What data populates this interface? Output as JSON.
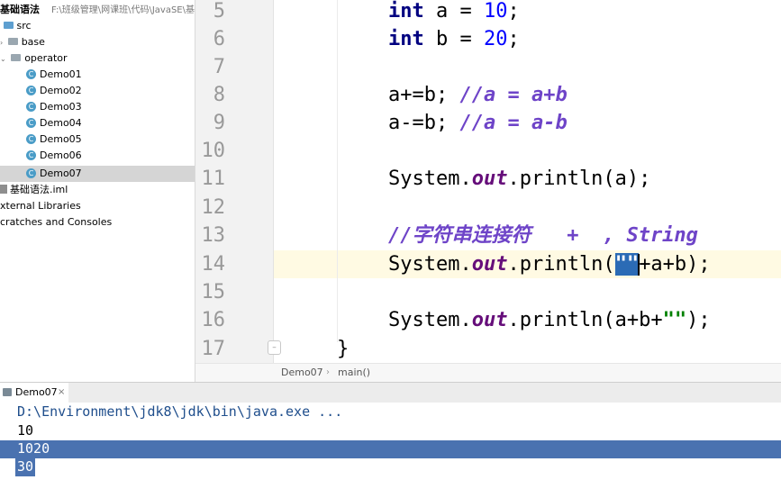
{
  "project": {
    "root_name": "基础语法",
    "root_path": "F:\\班级管理\\网课班\\代码\\JavaSE\\基础",
    "src_label": "src",
    "base_label": "base",
    "operator_label": "operator",
    "files": [
      "Demo01",
      "Demo02",
      "Demo03",
      "Demo04",
      "Demo05",
      "Demo06",
      "Demo07"
    ],
    "selected_file": "Demo07",
    "iml_label": "基础语法.iml",
    "external_libraries": "xternal Libraries",
    "scratches": "cratches and Consoles"
  },
  "editor": {
    "line_numbers": [
      "5",
      "6",
      "7",
      "8",
      "9",
      "10",
      "11",
      "12",
      "13",
      "14",
      "15",
      "16",
      "17"
    ],
    "current_line": "14",
    "code": {
      "l5_kw": "int",
      "l5_rest": " a = ",
      "l5_num": "10",
      "l5_end": ";",
      "l6_kw": "int",
      "l6_rest": " b = ",
      "l6_num": "20",
      "l6_end": ";",
      "l8_code": "a+=b; ",
      "l8_comment": "//a = a+b",
      "l9_code": "a-=b; ",
      "l9_comment": "//a = a-b",
      "l11_pre": "System.",
      "l11_field": "out",
      "l11_post": ".println(a);",
      "l13_comment": "//字符串连接符   +  , String",
      "l14_pre": "System.",
      "l14_field": "out",
      "l14_mid": ".println(",
      "l14_str": "\"\"",
      "l14_post": "+a+b);",
      "l16_pre": "System.",
      "l16_field": "out",
      "l16_mid": ".println(a+b+",
      "l16_str": "\"\"",
      "l16_post": ");",
      "l17_code": "}"
    },
    "breadcrumb": [
      "Demo07",
      "main()"
    ],
    "breadcrumb_sep": "›"
  },
  "run": {
    "tab_label": "Demo07",
    "tab_close": "×",
    "command": "D:\\Environment\\jdk8\\jdk\\bin\\java.exe ...",
    "output": [
      "10",
      "1020",
      "30"
    ]
  },
  "icons": {
    "folder": "folder-icon",
    "java_class": "java-class-icon",
    "module_file": "iml-file-icon",
    "run_tab": "run-icon",
    "fold": "fold-marker-icon"
  },
  "colors": {
    "keyword": "#000080",
    "number": "#0000ff",
    "comment": "#6e44c8",
    "field": "#660e7a",
    "string": "#008000",
    "current_line": "#fffae3",
    "selection": "#4a72b0"
  }
}
